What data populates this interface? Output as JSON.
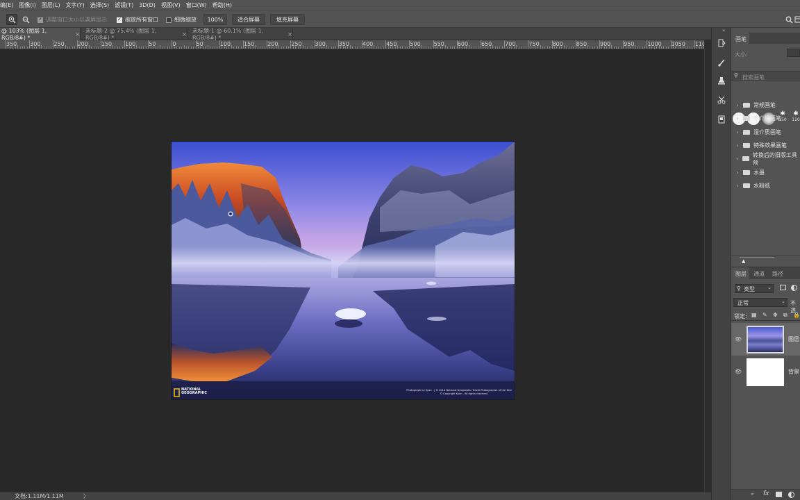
{
  "menu": [
    "编(E)",
    "图像(I)",
    "图层(L)",
    "文字(Y)",
    "选择(S)",
    "滤镜(T)",
    "3D(D)",
    "视图(V)",
    "窗口(W)",
    "帮助(H)"
  ],
  "options": {
    "resize_windows_label": "调整窗口大小以满屏显示",
    "zoom_all_label": "缩放所有窗口",
    "scrubby_zoom_label": "细微缩放",
    "zoom_value": "100%",
    "fit_screen_label": "适合屏幕",
    "fill_screen_label": "填充屏幕"
  },
  "tabs": [
    {
      "label": "@ 103% (图层 1, RGB/8#) *",
      "close": "×"
    },
    {
      "label": "未标题-2 @ 75.4% (图层 1, RGB/8#) *",
      "close": "×"
    },
    {
      "label": "未标题-1 @ 60.1% (图层 1, RGB/8#) *",
      "close": "×"
    }
  ],
  "ruler_labels": [
    "350",
    "300",
    "250",
    "200",
    "150",
    "100",
    "50",
    "0",
    "50",
    "100",
    "150",
    "200",
    "250",
    "300",
    "350",
    "400",
    "450",
    "500",
    "550",
    "600",
    "650",
    "700",
    "750",
    "800",
    "850",
    "900",
    "950",
    "1000",
    "1050",
    "110"
  ],
  "photo": {
    "watermark_logo_line1": "NATIONAL",
    "watermark_logo_line2": "GEOGRAPHIC",
    "credit_line1": "Photograph by Kyan .   | © 2014 National Geographic Travel Photographer of the Year",
    "credit_line2": "© Copyright Kyan .   All rights reserved."
  },
  "status": {
    "doc_size": "文档:1.11M/1.11M",
    "arrow": "〉"
  },
  "brush_panel": {
    "tab_label": "画笔",
    "size_label": "大小:",
    "search_placeholder": "搜索画笔",
    "preset_sizes": [
      "150",
      "110"
    ],
    "folders": [
      "常规画笔",
      "干介质画笔",
      "湿介质画笔",
      "特殊效果画笔",
      "转换后的旧版工具预",
      "水墨",
      "水粉纸"
    ]
  },
  "layers_panel": {
    "tabs": [
      "图层",
      "通道",
      "路径"
    ],
    "filter_kind": "类型",
    "blend_mode": "正常",
    "opacity_label": "不透",
    "lock_label": "锁定:",
    "layers": [
      {
        "name": "图层",
        "visible": true
      },
      {
        "name": "背景",
        "visible": true
      }
    ]
  },
  "colors": {
    "ui_dark": "#282828",
    "ui_mid": "#535353",
    "ui_panel": "#424242",
    "sky_top": "#4a5ad0",
    "sunset_orange": "#e06a2a"
  }
}
